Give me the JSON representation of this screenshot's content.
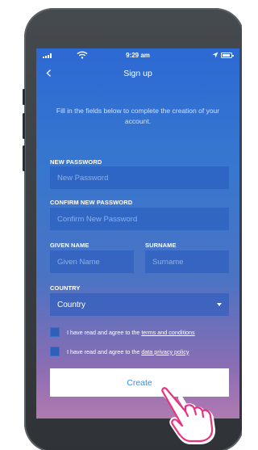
{
  "status_bar": {
    "time": "9:29 am"
  },
  "nav": {
    "title": "Sign up"
  },
  "intro": "Fill in the fields below to complete the creation of your account.",
  "form": {
    "new_password": {
      "label": "NEW PASSWORD",
      "placeholder": "New Password",
      "value": ""
    },
    "confirm_password": {
      "label": "CONFIRM NEW PASSWORD",
      "placeholder": "Confirm New Password",
      "value": ""
    },
    "given_name": {
      "label": "GIVEN NAME",
      "placeholder": "Given Name",
      "value": ""
    },
    "surname": {
      "label": "SURNAME",
      "placeholder": "Surname",
      "value": ""
    },
    "country": {
      "label": "COUNTRY",
      "selected": "Country"
    },
    "terms": {
      "text": "I have read and agree to the ",
      "link": "terms and conditions",
      "checked": false
    },
    "privacy": {
      "text": "I have read and agree to the ",
      "link": "data privacy policy",
      "checked": false
    },
    "create_label": "Create"
  },
  "colors": {
    "screen_top": "#2d69d3",
    "screen_bottom": "#b07ab2",
    "field_bg": "#2f5fb8",
    "button_text": "#3a8ae6"
  },
  "icons": {
    "back": "chevron-left-icon",
    "wifi": "wifi-icon",
    "location": "location-arrow-icon",
    "battery": "battery-icon",
    "dropdown": "caret-down-icon",
    "pointer": "pointing-hand-icon"
  }
}
